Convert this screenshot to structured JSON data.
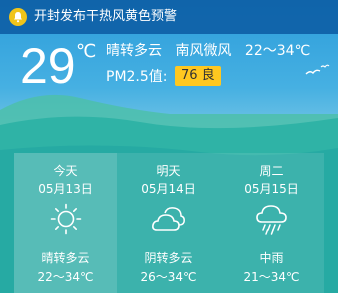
{
  "alert": {
    "text": "开封发布干热风黄色预警",
    "icon": "bell-icon"
  },
  "current": {
    "temperature": "29",
    "unit": "℃",
    "condition": "晴转多云",
    "wind": "南风微风",
    "range": "22～34℃",
    "pm_label": "PM2.5值:",
    "aqi": "76 良",
    "aqi_color": "#ffc820"
  },
  "forecast": [
    {
      "day": "今天",
      "date": "05月13日",
      "icon": "sunny-icon",
      "condition": "晴转多云",
      "range": "22～34℃"
    },
    {
      "day": "明天",
      "date": "05月14日",
      "icon": "cloudy-icon",
      "condition": "阴转多云",
      "range": "26～34℃"
    },
    {
      "day": "周二",
      "date": "05月15日",
      "icon": "rain-icon",
      "condition": "中雨",
      "range": "21～34℃"
    }
  ]
}
